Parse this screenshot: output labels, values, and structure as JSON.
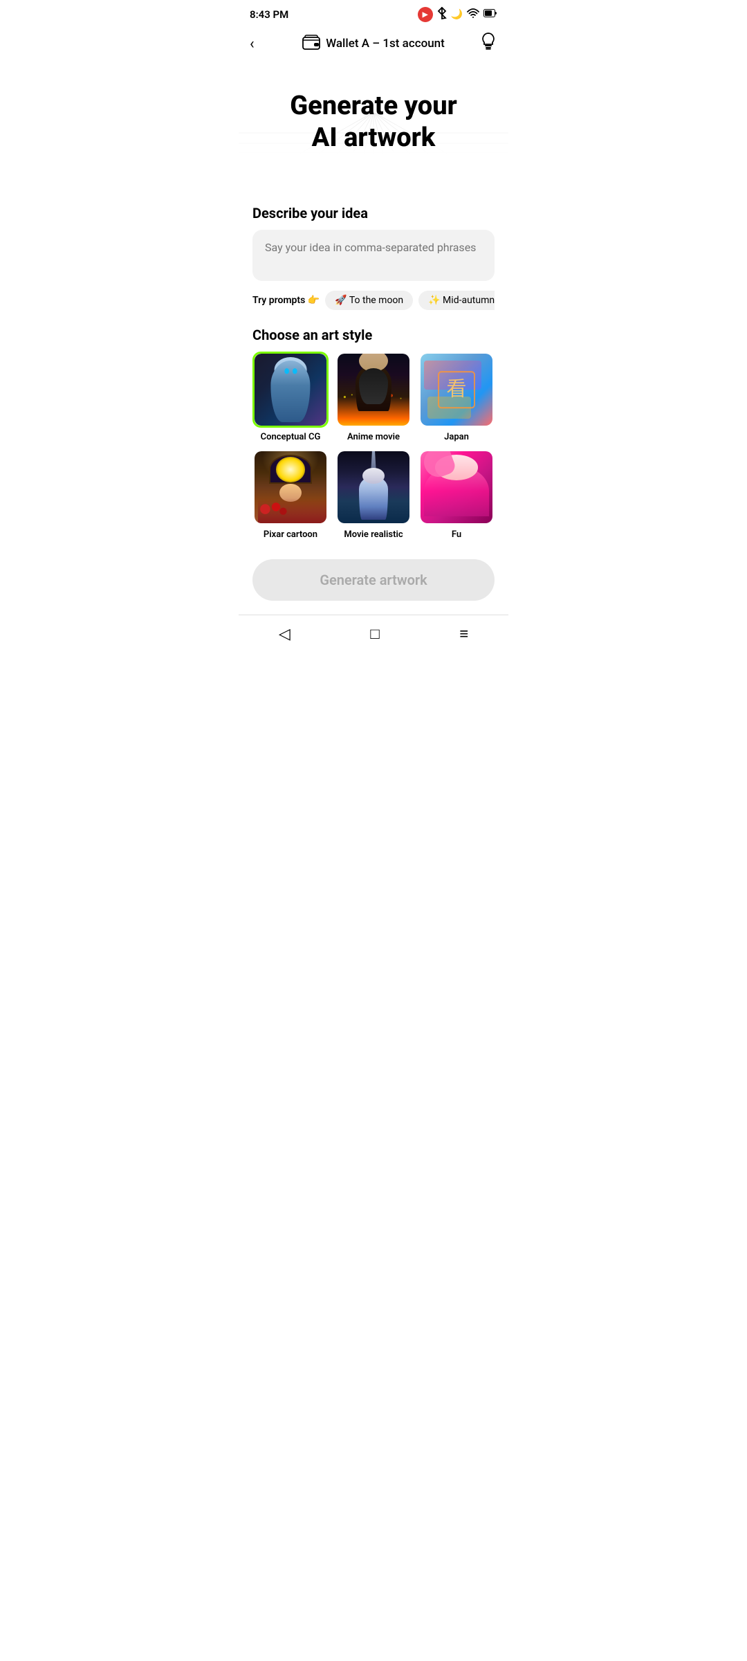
{
  "statusBar": {
    "time": "8:43 PM",
    "videoIcon": "📷",
    "btIcon": "bluetooth",
    "moonIcon": "🌙",
    "wifiIcon": "wifi",
    "batteryIcon": "battery"
  },
  "nav": {
    "backLabel": "‹",
    "walletLabel": "Wallet A – 1st account",
    "bulbIcon": "💡"
  },
  "hero": {
    "titleLine1": "Generate your",
    "titleLine2": "AI artwork"
  },
  "describe": {
    "sectionLabel": "Describe your idea",
    "inputPlaceholder": "Say your idea in comma-separated phrases"
  },
  "prompts": {
    "label": "Try prompts 👉",
    "chips": [
      "🚀 To the moon",
      "✨ Mid-autumn rabbits"
    ]
  },
  "artStyle": {
    "sectionLabel": "Choose an art style",
    "styles": [
      {
        "id": "conceptual-cg",
        "label": "Conceptual CG",
        "selected": true
      },
      {
        "id": "anime-movie",
        "label": "Anime movie",
        "selected": false
      },
      {
        "id": "japan",
        "label": "Japan",
        "selected": false
      },
      {
        "id": "pixar-cartoon",
        "label": "Pixar cartoon",
        "selected": false
      },
      {
        "id": "movie-realistic",
        "label": "Movie realistic",
        "selected": false
      },
      {
        "id": "fu",
        "label": "Fu",
        "selected": false
      }
    ]
  },
  "generateBtn": {
    "label": "Generate artwork"
  },
  "bottomNav": {
    "backSymbol": "◁",
    "homeSymbol": "□",
    "menuSymbol": "≡"
  }
}
